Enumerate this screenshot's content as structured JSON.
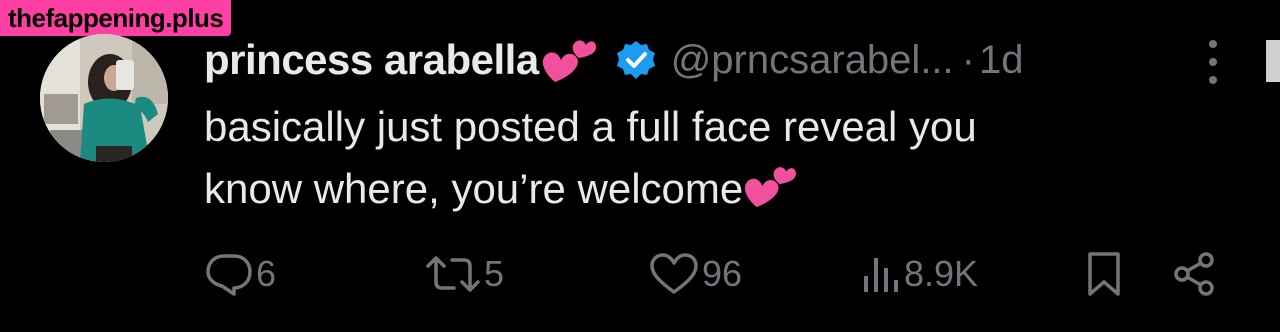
{
  "watermark": {
    "text": "thefappening.plus",
    "color": "#ff3fa3"
  },
  "tweet": {
    "display_name": "princess arabella",
    "name_emoji": "two-hearts-emoji",
    "verified_badge": "verified-badge-icon",
    "handle": "@prncsarabel...",
    "separator": "·",
    "timestamp": "1d",
    "text_line1": "basically just posted a full face reveal you",
    "text_line2": "know where, you’re welcome",
    "text_emoji": "two-hearts-emoji"
  },
  "actions": {
    "reply": {
      "icon": "reply-icon",
      "count": "6"
    },
    "retweet": {
      "icon": "retweet-icon",
      "count": "5"
    },
    "like": {
      "icon": "heart-icon",
      "count": "96"
    },
    "views": {
      "icon": "views-chart-icon",
      "count": "8.9K"
    },
    "bookmark": {
      "icon": "bookmark-icon"
    },
    "share": {
      "icon": "share-icon"
    }
  },
  "colors": {
    "background": "#000000",
    "primary_text": "#e7e9ea",
    "secondary_text": "#71767b",
    "verified_blue": "#1d9bf0",
    "emoji_pink": "#f0509c"
  }
}
